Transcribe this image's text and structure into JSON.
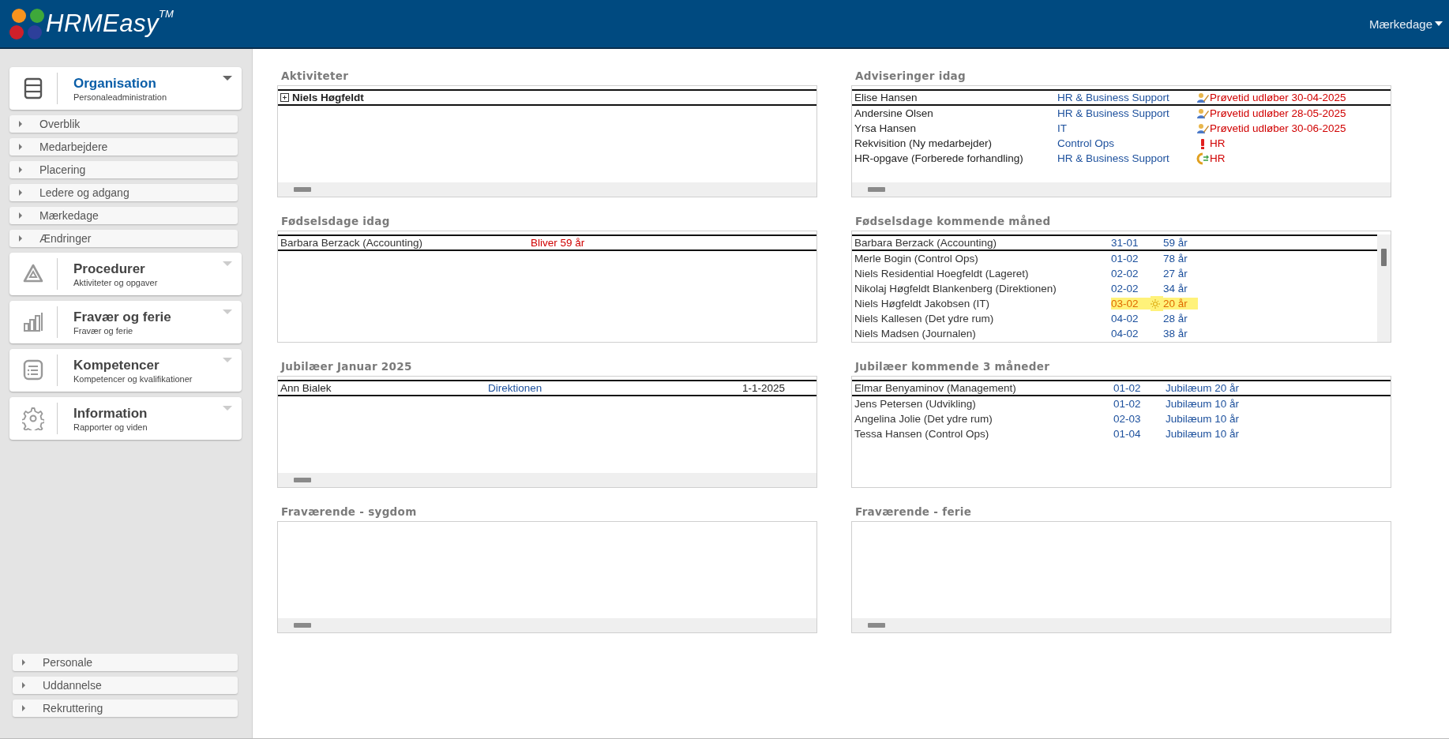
{
  "header": {
    "logo": {
      "name": "HRMEasy",
      "trademark": "TM"
    },
    "menu": {
      "label": "Mærkedage"
    }
  },
  "sidebar": {
    "modules": [
      {
        "title": "Organisation",
        "subtitle": "Personaleadministration",
        "expanded": true,
        "items": [
          "Overblik",
          "Medarbejdere",
          "Placering",
          "Ledere og adgang",
          "Mærkedage",
          "Ændringer"
        ]
      },
      {
        "title": "Procedurer",
        "subtitle": "Aktiviteter og opgaver",
        "expanded": false
      },
      {
        "title": "Fravær og ferie",
        "subtitle": "Fravær og ferie",
        "expanded": false
      },
      {
        "title": "Kompetencer",
        "subtitle": "Kompetencer og kvalifikationer",
        "expanded": false
      },
      {
        "title": "Information",
        "subtitle": "Rapporter og viden",
        "expanded": false
      }
    ],
    "bottom_items": [
      "Personale",
      "Uddannelse",
      "Rekruttering"
    ]
  },
  "panels": [
    {
      "title": "Aktiviteter",
      "kind": "activities",
      "rows": [
        {
          "cells": [
            "Niels Høgfeldt"
          ],
          "selected": true,
          "expanded": false
        }
      ]
    },
    {
      "title": "Adviseringer idag",
      "kind": "advisories",
      "rows": [
        {
          "cells": [
            "Elise Hansen",
            "HR & Business Support",
            "Prøvetid udløber 30-04-2025"
          ],
          "kind": "probation",
          "selected": true
        },
        {
          "cells": [
            "Andersine Olsen",
            "HR & Business Support",
            "Prøvetid udløber 28-05-2025"
          ],
          "kind": "probation",
          "selected": false
        },
        {
          "cells": [
            "Yrsa Hansen",
            "IT",
            "Prøvetid udløber 30-06-2025"
          ],
          "kind": "probation",
          "selected": false
        },
        {
          "cells": [
            "Rekvisition (Ny medarbejder)",
            "Control Ops",
            "HR"
          ],
          "kind": "requisition",
          "selected": false
        },
        {
          "cells": [
            "HR-opgave (Forberede forhandling)",
            "HR & Business Support",
            "HR"
          ],
          "kind": "task",
          "selected": false
        }
      ]
    },
    {
      "title": "Fødselsdage idag",
      "kind": "birthdays-today",
      "rows": [
        {
          "cells": [
            "Barbara Berzack (Accounting)",
            "Bliver 59 år"
          ],
          "selected": true
        }
      ]
    },
    {
      "title": "Fødselsdage kommende måned",
      "kind": "birthdays-month",
      "rows": [
        {
          "cells": [
            "Barbara Berzack (Accounting)",
            "31-01",
            "59 år"
          ],
          "selected": true,
          "highlighted": false
        },
        {
          "cells": [
            "Merle Bogin (Control Ops)",
            "01-02",
            "78 år"
          ],
          "selected": false,
          "highlighted": false
        },
        {
          "cells": [
            "Niels Residential Hoegfeldt (Lageret)",
            "02-02",
            "27 år"
          ],
          "selected": false,
          "highlighted": false
        },
        {
          "cells": [
            "Nikolaj Høgfeldt Blankenberg (Direktionen)",
            "02-02",
            "34 år"
          ],
          "selected": false,
          "highlighted": false
        },
        {
          "cells": [
            "Niels Høgfeldt Jakobsen (IT)",
            "03-02",
            "20 år"
          ],
          "selected": false,
          "highlighted": true
        },
        {
          "cells": [
            "Niels Kallesen (Det ydre rum)",
            "04-02",
            "28 år"
          ],
          "selected": false,
          "highlighted": false
        },
        {
          "cells": [
            "Niels Madsen (Journalen)",
            "04-02",
            "38 år"
          ],
          "selected": false,
          "highlighted": false
        }
      ]
    },
    {
      "title": "Jubilæer Januar 2025",
      "kind": "anniversaries",
      "rows": [
        {
          "cells": [
            "Ann Bialek",
            "Direktionen",
            "1-1-2025"
          ],
          "selected": true
        }
      ]
    },
    {
      "title": "Jubilæer kommende 3 måneder",
      "kind": "anniversaries-upcoming",
      "rows": [
        {
          "cells": [
            "Elmar Benyaminov (Management)",
            "01-02",
            "Jubilæum 20 år"
          ],
          "selected": true
        },
        {
          "cells": [
            "Jens Petersen (Udvikling)",
            "01-02",
            "Jubilæum 10 år"
          ],
          "selected": false
        },
        {
          "cells": [
            "Angelina Jolie (Det ydre rum)",
            "02-03",
            "Jubilæum 10 år"
          ],
          "selected": false
        },
        {
          "cells": [
            "Tessa Hansen (Control Ops)",
            "01-04",
            "Jubilæum 10 år"
          ],
          "selected": false
        }
      ]
    },
    {
      "title": "Fraværende - sygdom",
      "kind": "absence"
    },
    {
      "title": "Fraværende - ferie",
      "kind": "absence"
    }
  ]
}
